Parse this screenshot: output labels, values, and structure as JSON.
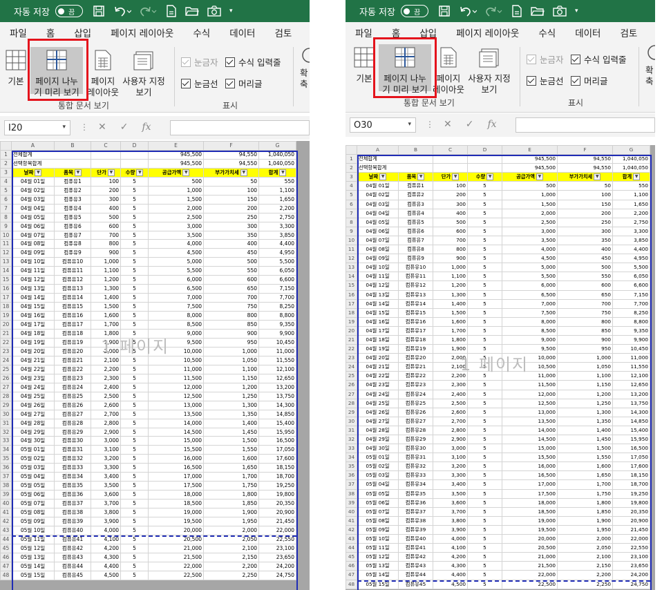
{
  "colors": {
    "titlebar": "#217346",
    "ribbon": "#f3f3f3",
    "highlight_box": "#e4131c",
    "page_break": "#1f2cb5",
    "header_fill": "#ffff00"
  },
  "titlebar": {
    "autosave": "자동 저장",
    "toggle": "끔",
    "icons": [
      "save-icon",
      "undo-icon",
      "redo-icon",
      "new-doc-icon",
      "open-folder-icon",
      "camera-icon",
      "customize-dropdown-icon"
    ]
  },
  "tabs": [
    "파일",
    "홈",
    "삽입",
    "페이지 레이아웃",
    "수식",
    "데이터",
    "검토"
  ],
  "ribbon": {
    "views": [
      "기본",
      "페이지 나누\n기 미리 보기",
      "페이지\n레이아웃",
      "사용자 지정\n보기"
    ],
    "views_group": "통합 문서 보기",
    "show": {
      "ruler": "눈금자",
      "formula_bar": "수식 입력줄",
      "gridlines": "눈금선",
      "headings": "머리글"
    },
    "show_group": "표시",
    "zoom_partial": "확",
    "zoom_partial2": "축"
  },
  "left": {
    "namebox": "I20",
    "watermark": "1 페이지"
  },
  "right": {
    "namebox": "O30",
    "watermark": "1 페이지"
  },
  "formula": {
    "cancel": "✕",
    "enter": "✓",
    "fx": "fx"
  },
  "sheet": {
    "columns": [
      "A",
      "B",
      "C",
      "D",
      "E",
      "F",
      "G"
    ],
    "summary": [
      {
        "label": "전체합계",
        "e": "945,500",
        "f": "94,550",
        "g": "1,040,050"
      },
      {
        "label": "선택항목합계",
        "e": "945,500",
        "f": "94,550",
        "g": "1,040,050"
      }
    ],
    "headers": [
      "날짜",
      "품목",
      "단가",
      "수량",
      "공급가액",
      "부가가치세",
      "합계"
    ],
    "rows": [
      [
        "04월 01일",
        "컴퓨유1",
        "100",
        "5",
        "500",
        "50",
        "550"
      ],
      [
        "04월 02일",
        "컴퓨유2",
        "200",
        "5",
        "1,000",
        "100",
        "1,100"
      ],
      [
        "04월 03일",
        "컴퓨유3",
        "300",
        "5",
        "1,500",
        "150",
        "1,650"
      ],
      [
        "04월 04일",
        "컴퓨유4",
        "400",
        "5",
        "2,000",
        "200",
        "2,200"
      ],
      [
        "04월 05일",
        "컴퓨유5",
        "500",
        "5",
        "2,500",
        "250",
        "2,750"
      ],
      [
        "04월 06일",
        "컴퓨유6",
        "600",
        "5",
        "3,000",
        "300",
        "3,300"
      ],
      [
        "04월 07일",
        "컴퓨유7",
        "700",
        "5",
        "3,500",
        "350",
        "3,850"
      ],
      [
        "04월 08일",
        "컴퓨유8",
        "800",
        "5",
        "4,000",
        "400",
        "4,400"
      ],
      [
        "04월 09일",
        "컴퓨유9",
        "900",
        "5",
        "4,500",
        "450",
        "4,950"
      ],
      [
        "04월 10일",
        "컴퓨유10",
        "1,000",
        "5",
        "5,000",
        "500",
        "5,500"
      ],
      [
        "04월 11일",
        "컴퓨유11",
        "1,100",
        "5",
        "5,500",
        "550",
        "6,050"
      ],
      [
        "04월 12일",
        "컴퓨유12",
        "1,200",
        "5",
        "6,000",
        "600",
        "6,600"
      ],
      [
        "04월 13일",
        "컴퓨유13",
        "1,300",
        "5",
        "6,500",
        "650",
        "7,150"
      ],
      [
        "04월 14일",
        "컴퓨유14",
        "1,400",
        "5",
        "7,000",
        "700",
        "7,700"
      ],
      [
        "04월 15일",
        "컴퓨유15",
        "1,500",
        "5",
        "7,500",
        "750",
        "8,250"
      ],
      [
        "04월 16일",
        "컴퓨유16",
        "1,600",
        "5",
        "8,000",
        "800",
        "8,800"
      ],
      [
        "04월 17일",
        "컴퓨유17",
        "1,700",
        "5",
        "8,500",
        "850",
        "9,350"
      ],
      [
        "04월 18일",
        "컴퓨유18",
        "1,800",
        "5",
        "9,000",
        "900",
        "9,900"
      ],
      [
        "04월 19일",
        "컴퓨유19",
        "1,900",
        "5",
        "9,500",
        "950",
        "10,450"
      ],
      [
        "04월 20일",
        "컴퓨유20",
        "2,000",
        "5",
        "10,000",
        "1,000",
        "11,000"
      ],
      [
        "04월 21일",
        "컴퓨유21",
        "2,100",
        "5",
        "10,500",
        "1,050",
        "11,550"
      ],
      [
        "04월 22일",
        "컴퓨유22",
        "2,200",
        "5",
        "11,000",
        "1,100",
        "12,100"
      ],
      [
        "04월 23일",
        "컴퓨유23",
        "2,300",
        "5",
        "11,500",
        "1,150",
        "12,650"
      ],
      [
        "04월 24일",
        "컴퓨유24",
        "2,400",
        "5",
        "12,000",
        "1,200",
        "13,200"
      ],
      [
        "04월 25일",
        "컴퓨유25",
        "2,500",
        "5",
        "12,500",
        "1,250",
        "13,750"
      ],
      [
        "04월 26일",
        "컴퓨유26",
        "2,600",
        "5",
        "13,000",
        "1,300",
        "14,300"
      ],
      [
        "04월 27일",
        "컴퓨유27",
        "2,700",
        "5",
        "13,500",
        "1,350",
        "14,850"
      ],
      [
        "04월 28일",
        "컴퓨유28",
        "2,800",
        "5",
        "14,000",
        "1,400",
        "15,400"
      ],
      [
        "04월 29일",
        "컴퓨유29",
        "2,900",
        "5",
        "14,500",
        "1,450",
        "15,950"
      ],
      [
        "04월 30일",
        "컴퓨유30",
        "3,000",
        "5",
        "15,000",
        "1,500",
        "16,500"
      ],
      [
        "05월 01일",
        "컴퓨유31",
        "3,100",
        "5",
        "15,500",
        "1,550",
        "17,050"
      ],
      [
        "05월 02일",
        "컴퓨유32",
        "3,200",
        "5",
        "16,000",
        "1,600",
        "17,600"
      ],
      [
        "05월 03일",
        "컴퓨유33",
        "3,300",
        "5",
        "16,500",
        "1,650",
        "18,150"
      ],
      [
        "05월 04일",
        "컴퓨유34",
        "3,400",
        "5",
        "17,000",
        "1,700",
        "18,700"
      ],
      [
        "05월 05일",
        "컴퓨유35",
        "3,500",
        "5",
        "17,500",
        "1,750",
        "19,250"
      ],
      [
        "05월 06일",
        "컴퓨유36",
        "3,600",
        "5",
        "18,000",
        "1,800",
        "19,800"
      ],
      [
        "05월 07일",
        "컴퓨유37",
        "3,700",
        "5",
        "18,500",
        "1,850",
        "20,350"
      ],
      [
        "05월 08일",
        "컴퓨유38",
        "3,800",
        "5",
        "19,000",
        "1,900",
        "20,900"
      ],
      [
        "05월 09일",
        "컴퓨유39",
        "3,900",
        "5",
        "19,500",
        "1,950",
        "21,450"
      ],
      [
        "05월 10일",
        "컴퓨유40",
        "4,000",
        "5",
        "20,000",
        "2,000",
        "22,000"
      ],
      [
        "05월 11일",
        "컴퓨유41",
        "4,100",
        "5",
        "20,500",
        "2,050",
        "22,550"
      ],
      [
        "05월 12일",
        "컴퓨유42",
        "4,200",
        "5",
        "21,000",
        "2,100",
        "23,100"
      ],
      [
        "05월 13일",
        "컴퓨유43",
        "4,300",
        "5",
        "21,500",
        "2,150",
        "23,650"
      ],
      [
        "05월 14일",
        "컴퓨유44",
        "4,400",
        "5",
        "22,000",
        "2,200",
        "24,200"
      ],
      [
        "05월 15일",
        "컴퓨유45",
        "4,500",
        "5",
        "22,500",
        "2,250",
        "24,750"
      ]
    ]
  }
}
